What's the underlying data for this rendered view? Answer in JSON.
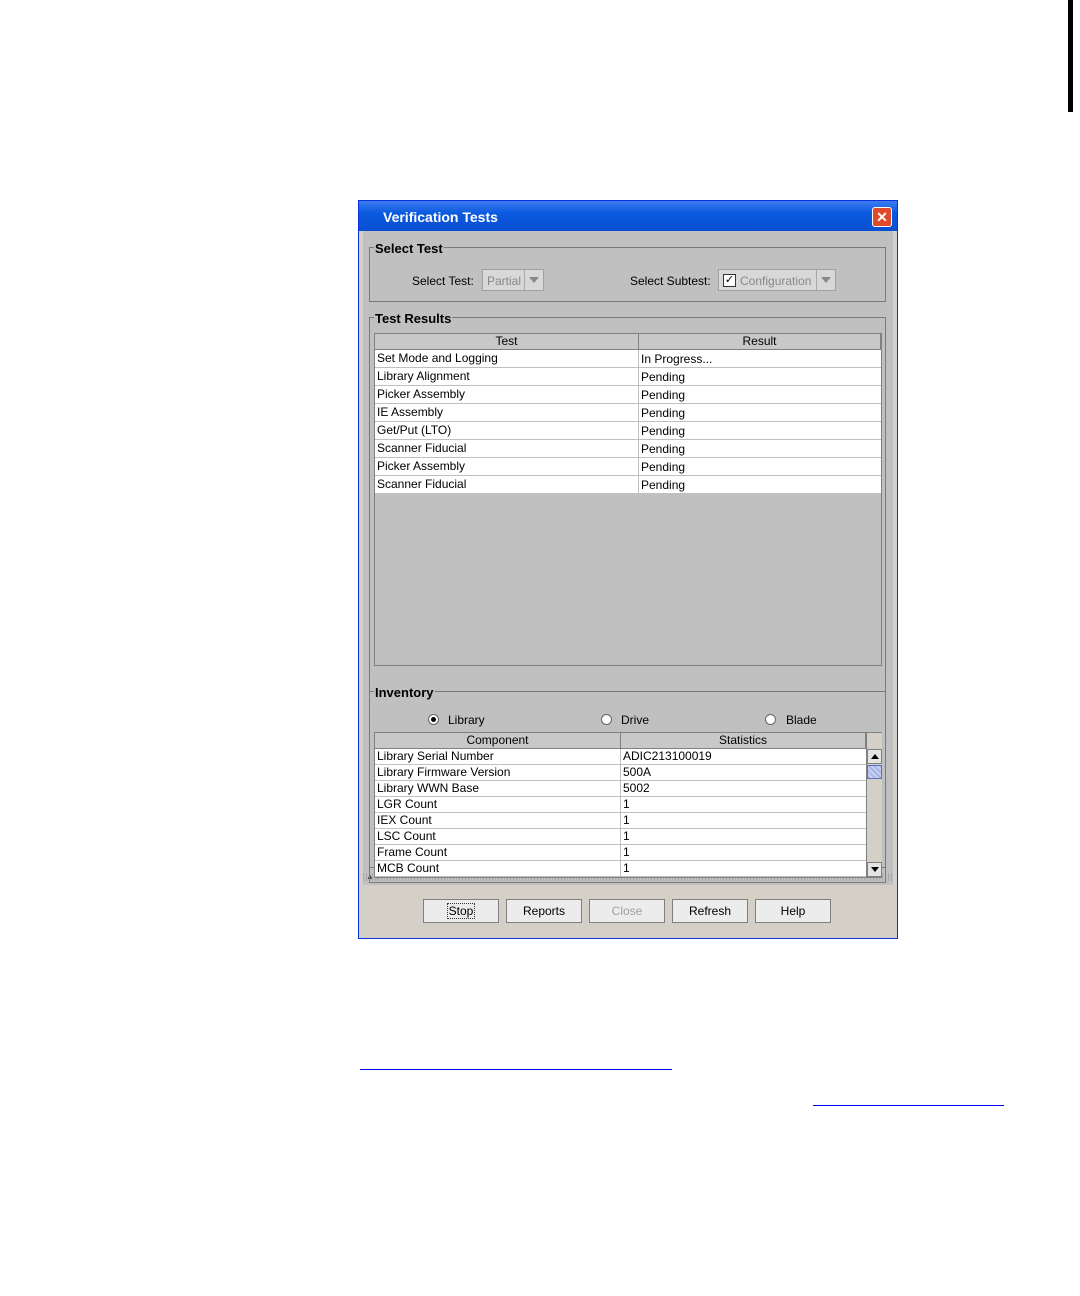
{
  "window": {
    "title": "Verification Tests"
  },
  "select_test_group": {
    "legend": "Select Test",
    "select_test_label": "Select Test:",
    "select_test_value": "Partial",
    "select_subtest_label": "Select Subtest:",
    "select_subtest_value": "Configuration",
    "subtest_checked": true
  },
  "results_group": {
    "legend": "Test Results",
    "columns": [
      "Test",
      "Result"
    ],
    "rows": [
      [
        "Set Mode and Logging",
        "In Progress..."
      ],
      [
        "Library Alignment",
        "Pending"
      ],
      [
        "Picker Assembly",
        "Pending"
      ],
      [
        "IE Assembly",
        "Pending"
      ],
      [
        "Get/Put (LTO)",
        "Pending"
      ],
      [
        "Scanner Fiducial",
        "Pending"
      ],
      [
        "Picker Assembly",
        "Pending"
      ],
      [
        "Scanner Fiducial",
        "Pending"
      ]
    ]
  },
  "inventory_group": {
    "legend": "Inventory",
    "radios": [
      {
        "label": "Library",
        "selected": true
      },
      {
        "label": "Drive",
        "selected": false
      },
      {
        "label": "Blade",
        "selected": false
      }
    ],
    "columns": [
      "Component",
      "Statistics"
    ],
    "rows": [
      [
        "Library Serial Number",
        "ADIC213100019"
      ],
      [
        "Library Firmware Version",
        "500A"
      ],
      [
        "Library WWN Base",
        "5002"
      ],
      [
        "LGR Count",
        "1"
      ],
      [
        "IEX Count",
        "1"
      ],
      [
        "LSC Count",
        "1"
      ],
      [
        "Frame Count",
        "1"
      ],
      [
        "MCB Count",
        "1"
      ]
    ]
  },
  "buttons": {
    "stop": "Stop",
    "reports": "Reports",
    "close": "Close",
    "refresh": "Refresh",
    "help": "Help"
  },
  "colors": {
    "titlebar": "#0a5ae0",
    "link_underline": "#0000ff"
  }
}
